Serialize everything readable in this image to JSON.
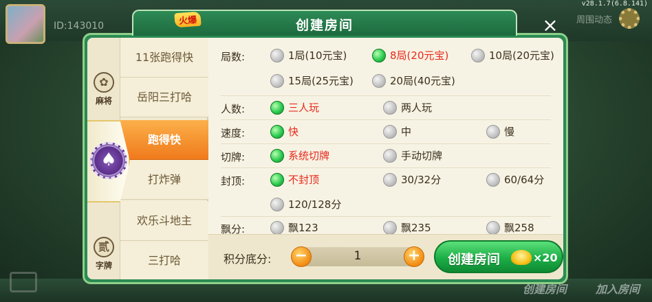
{
  "app": {
    "version": "v28.1.7(6.8.141)",
    "user_id": "ID:143010",
    "bg_corner_text": "周围动态",
    "bg_buttons": [
      "创建房间",
      "加入房间"
    ]
  },
  "dialog": {
    "title": "创建房间",
    "close_icon": "×"
  },
  "categories": [
    {
      "label": "麻将",
      "icon": "mahjong-icon",
      "glyph": "✿"
    },
    {
      "label": "",
      "icon": "poker-chip-icon",
      "glyph": "♠",
      "active": true
    },
    {
      "label": "字牌",
      "icon": "zipai-icon",
      "glyph": "贰"
    }
  ],
  "games": [
    {
      "label": "11张跑得快",
      "active": false
    },
    {
      "label": "岳阳三打哈",
      "active": false
    },
    {
      "label": "跑得快",
      "active": true
    },
    {
      "label": "打炸弹",
      "active": false
    },
    {
      "label": "欢乐斗地主",
      "active": false
    },
    {
      "label": "三打哈",
      "active": false
    }
  ],
  "hot_badge": "火爆",
  "options": {
    "rounds": {
      "label": "局数:",
      "choices": [
        "1局(10元宝)",
        "8局(20元宝)",
        "10局(20元宝)",
        "15局(25元宝)",
        "20局(40元宝)"
      ],
      "selected": 1
    },
    "players": {
      "label": "人数:",
      "choices": [
        "三人玩",
        "两人玩"
      ],
      "selected": 0
    },
    "speed": {
      "label": "速度:",
      "choices": [
        "快",
        "中",
        "慢"
      ],
      "selected": 0
    },
    "cut": {
      "label": "切牌:",
      "choices": [
        "系统切牌",
        "手动切牌"
      ],
      "selected": 0
    },
    "cap": {
      "label": "封顶:",
      "choices": [
        "不封顶",
        "30/32分",
        "60/64分",
        "120/128分"
      ],
      "selected": 0
    },
    "float": {
      "label": "飘分:",
      "choices": [
        "飘123",
        "飘235",
        "飘258"
      ],
      "selected": -1
    }
  },
  "bottom": {
    "score_label": "积分底分:",
    "minus": "−",
    "plus": "+",
    "value": "1",
    "create_label": "创建房间",
    "cost": "×20"
  },
  "colors": {
    "accent_green": "#1cae46",
    "active_orange": "#f07a1c",
    "selected_text": "#e8281c"
  }
}
